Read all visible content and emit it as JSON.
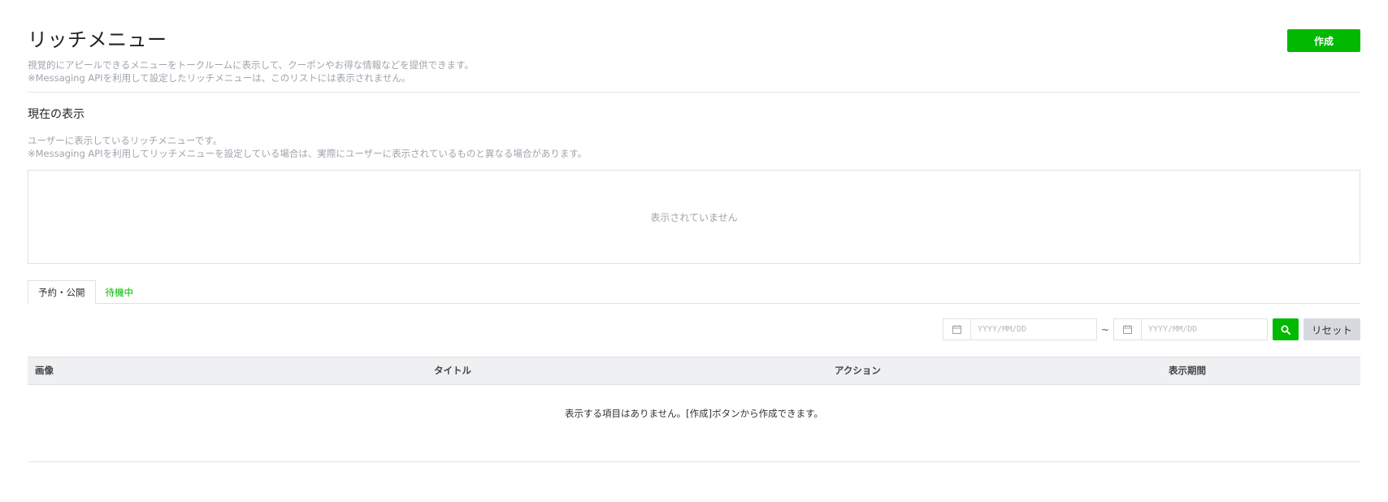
{
  "header": {
    "title": "リッチメニュー",
    "description_line1": "視覚的にアピールできるメニューをトークルームに表示して、クーポンやお得な情報などを提供できます。",
    "description_line2": "※Messaging APIを利用して設定したリッチメニューは、このリストには表示されません。",
    "create_label": "作成"
  },
  "current_display": {
    "title": "現在の表示",
    "description_line1": "ユーザーに表示しているリッチメニューです。",
    "description_line2": "※Messaging APIを利用してリッチメニューを設定している場合は、実際にユーザーに表示されているものと異なる場合があります。",
    "empty_text": "表示されていません"
  },
  "tabs": [
    {
      "label": "予約・公開",
      "active": true
    },
    {
      "label": "待機中",
      "active": false
    }
  ],
  "filter": {
    "start_placeholder": "YYYY/MM/DD",
    "end_placeholder": "YYYY/MM/DD",
    "separator": "~",
    "reset_label": "リセット",
    "icons": {
      "date": "calendar-icon",
      "search": "search-icon"
    }
  },
  "table": {
    "columns": [
      "画像",
      "タイトル",
      "アクション",
      "表示期間"
    ],
    "empty_text": "表示する項目はありません。[作成]ボタンから作成できます。"
  },
  "colors": {
    "accent": "#00b900",
    "muted_text": "#a0a4ab",
    "table_header_bg": "#eef0f2",
    "reset_bg": "#d6d9de"
  }
}
